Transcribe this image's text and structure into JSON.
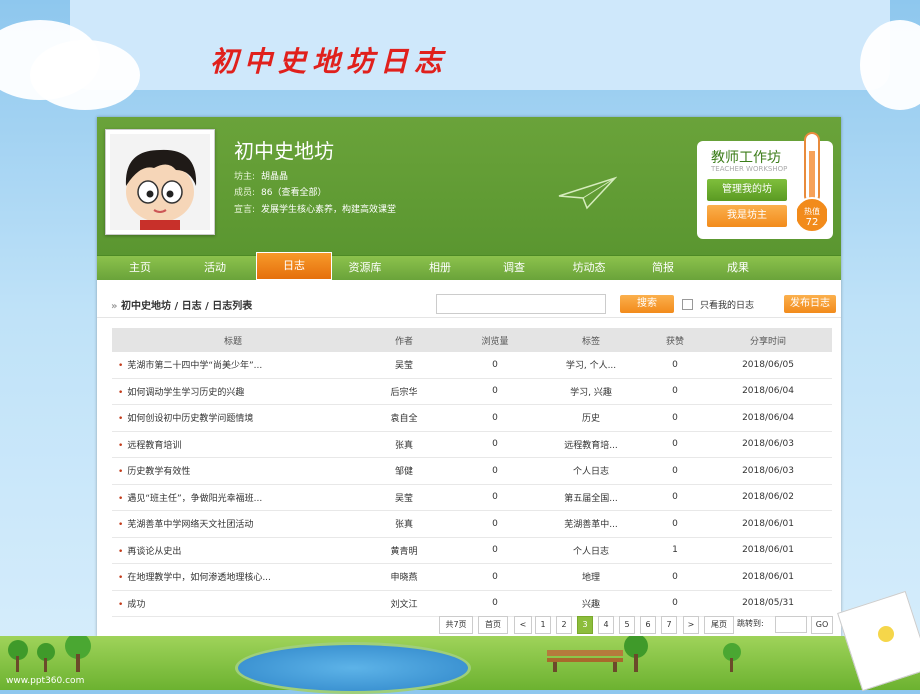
{
  "slide": {
    "title": "初中史地坊日志",
    "watermark": "www.ppt360.com"
  },
  "header": {
    "site_name": "初中史地坊",
    "owner_label": "坊主:",
    "owner": "胡晶晶",
    "members_label": "成员:",
    "members": "86（查看全部）",
    "motto_label": "宣言:",
    "motto": "发展学生核心素养，构建高效课堂"
  },
  "workshop": {
    "title": "教师工作坊",
    "subtitle": "TEACHER WORKSHOP",
    "manage_label": "管理我的坊",
    "owner_btn_label": "我是坊主",
    "heat_label": "热值",
    "heat_value": "72"
  },
  "nav": {
    "items": [
      "主页",
      "活动",
      "日志",
      "资源库",
      "相册",
      "调查",
      "坊动态",
      "简报",
      "成果"
    ],
    "active": "日志"
  },
  "breadcrumb": {
    "root": "初中史地坊",
    "sep": "/",
    "level2": "日志",
    "level3": "日志列表"
  },
  "search": {
    "value": "",
    "button_label": "搜索",
    "only_mine_label": "只看我的日志",
    "publish_label": "发布日志"
  },
  "table": {
    "headers": [
      "标题",
      "作者",
      "浏览量",
      "标签",
      "获赞",
      "分享时间"
    ],
    "rows": [
      [
        "芜湖市第二十四中学“尚美少年”...",
        "吴莹",
        "0",
        "学习, 个人...",
        "0",
        "2018/06/05"
      ],
      [
        "如何调动学生学习历史的兴趣",
        "后宗华",
        "0",
        "学习, 兴趣",
        "0",
        "2018/06/04"
      ],
      [
        "如何创设初中历史教学问题情境",
        "袁自全",
        "0",
        "历史",
        "0",
        "2018/06/04"
      ],
      [
        "远程教育培训",
        "张真",
        "0",
        "远程教育培...",
        "0",
        "2018/06/03"
      ],
      [
        "历史教学有效性",
        "邹健",
        "0",
        "个人日志",
        "0",
        "2018/06/03"
      ],
      [
        "遇见“班主任”，争做阳光幸福班...",
        "吴莹",
        "0",
        "第五届全国...",
        "0",
        "2018/06/02"
      ],
      [
        "芜湖善革中学网络天文社团活动",
        "张真",
        "0",
        "芜湖善革中...",
        "0",
        "2018/06/01"
      ],
      [
        "再谈论从史出",
        "黄青明",
        "0",
        "个人日志",
        "1",
        "2018/06/01"
      ],
      [
        "在地理教学中，如何渗透地理核心...",
        "申晓燕",
        "0",
        "地理",
        "0",
        "2018/06/01"
      ],
      [
        "成功",
        "刘文江",
        "0",
        "兴趣",
        "0",
        "2018/05/31"
      ]
    ]
  },
  "pager": {
    "total": "共7页",
    "first": "首页",
    "prev": "<",
    "pages": [
      "1",
      "2",
      "3",
      "4",
      "5",
      "6",
      "7"
    ],
    "current": "3",
    "next": ">",
    "last": "尾页",
    "jump_label": "跳转到:",
    "jump_value": "",
    "go": "GO"
  },
  "colors": {
    "green": "#5a9630",
    "orange": "#f28b1b",
    "active_page": "#8cbd3b"
  }
}
